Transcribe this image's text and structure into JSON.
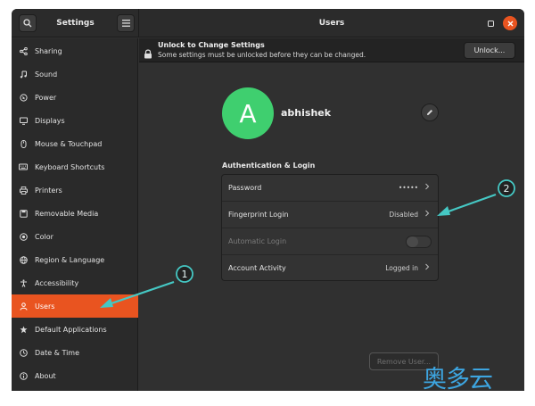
{
  "header": {
    "sidebar_title": "Settings",
    "main_title": "Users",
    "search_icon": "search-icon",
    "menu_icon": "hamburger-menu-icon"
  },
  "sidebar": {
    "items": [
      {
        "label": "Sharing",
        "icon": "share-icon"
      },
      {
        "label": "Sound",
        "icon": "music-note-icon"
      },
      {
        "label": "Power",
        "icon": "power-icon"
      },
      {
        "label": "Displays",
        "icon": "display-icon"
      },
      {
        "label": "Mouse & Touchpad",
        "icon": "mouse-icon"
      },
      {
        "label": "Keyboard Shortcuts",
        "icon": "keyboard-icon"
      },
      {
        "label": "Printers",
        "icon": "printer-icon"
      },
      {
        "label": "Removable Media",
        "icon": "media-icon"
      },
      {
        "label": "Color",
        "icon": "color-icon"
      },
      {
        "label": "Region & Language",
        "icon": "globe-icon"
      },
      {
        "label": "Accessibility",
        "icon": "accessibility-icon"
      },
      {
        "label": "Users",
        "icon": "users-icon",
        "active": true
      },
      {
        "label": "Default Applications",
        "icon": "star-icon"
      },
      {
        "label": "Date & Time",
        "icon": "clock-icon"
      },
      {
        "label": "About",
        "icon": "info-icon"
      }
    ]
  },
  "infobar": {
    "title": "Unlock to Change Settings",
    "subtitle": "Some settings must be unlocked before they can be changed.",
    "unlock_label": "Unlock..."
  },
  "user": {
    "avatar_letter": "A",
    "name": "abhishek"
  },
  "auth": {
    "heading": "Authentication & Login",
    "rows": [
      {
        "label": "Password",
        "value": "•••••"
      },
      {
        "label": "Fingerprint Login",
        "value": "Disabled"
      },
      {
        "label": "Automatic Login",
        "value": ""
      },
      {
        "label": "Account Activity",
        "value": "Logged in"
      }
    ]
  },
  "remove_user_label": "Remove User...",
  "annotations": {
    "marker_1": "1",
    "marker_2": "2"
  },
  "watermark": "奥多云",
  "colors": {
    "accent": "#e95420",
    "avatar": "#3fcf6f",
    "annotation": "#45c8c4"
  }
}
